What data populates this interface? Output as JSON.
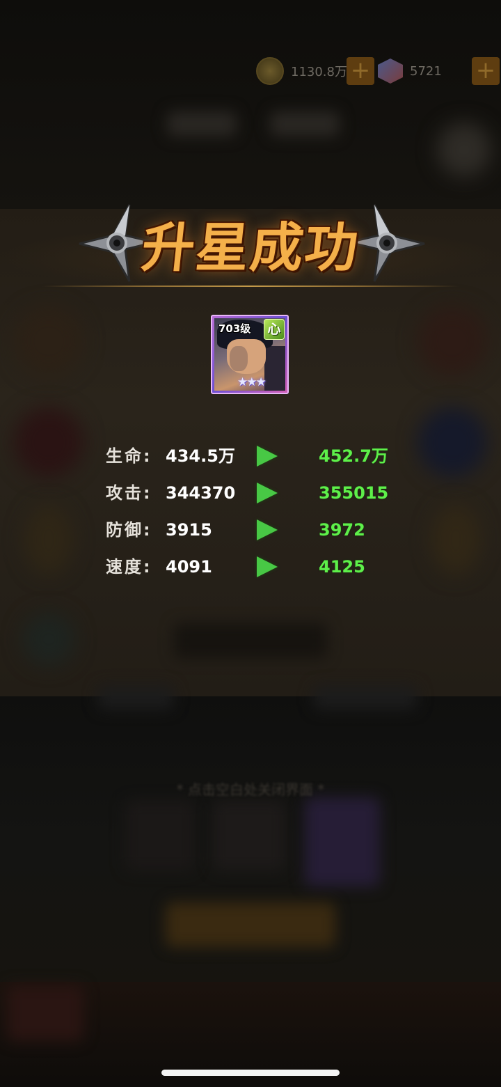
{
  "currency": {
    "coins": "1130.8万",
    "gems": "5721",
    "coin_icon": "coin-icon",
    "gem_icon": "gem-icon",
    "add_symbol": "+"
  },
  "title": "升星成功",
  "hero": {
    "level": "703级",
    "attribute": "心",
    "stars": "★★★",
    "attribute_color": "#7fc43a",
    "rarity_border": "#e7b7f7"
  },
  "stats": [
    {
      "label": "生命:",
      "old": "434.5万",
      "new": "452.7万"
    },
    {
      "label": "攻击:",
      "old": "344370",
      "new": "355015"
    },
    {
      "label": "防御:",
      "old": "3915",
      "new": "3972"
    },
    {
      "label": "速度:",
      "old": "4091",
      "new": "4125"
    }
  ],
  "colors": {
    "new_value": "#5ef04a",
    "arrow": "#48c845",
    "title": "#f4b04a"
  },
  "close_hint": "* 点击空白处关闭界面 *"
}
